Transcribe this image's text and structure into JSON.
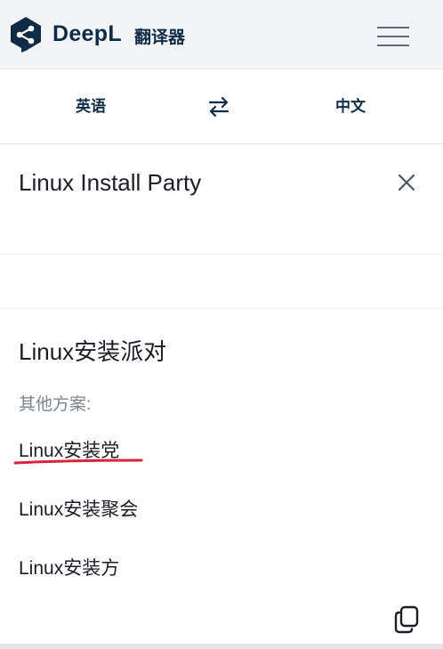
{
  "header": {
    "brand": "DeepL",
    "brand_sub": "翻译器",
    "logo_icon": "deepl-logo-icon",
    "menu_icon": "hamburger-menu-icon",
    "brand_color": "#0f2b46"
  },
  "languages": {
    "source": "英语",
    "target": "中文",
    "swap_icon": "swap-arrows-icon"
  },
  "source": {
    "text": "Linux Install Party",
    "clear_icon": "close-icon"
  },
  "result": {
    "main": "Linux安装派对",
    "alternatives_label": "其他方案:",
    "alternatives": [
      "Linux安装党",
      "Linux安装聚会",
      "Linux安装方"
    ],
    "copy_icon": "copy-icon",
    "annotation_color": "#d9233d"
  }
}
